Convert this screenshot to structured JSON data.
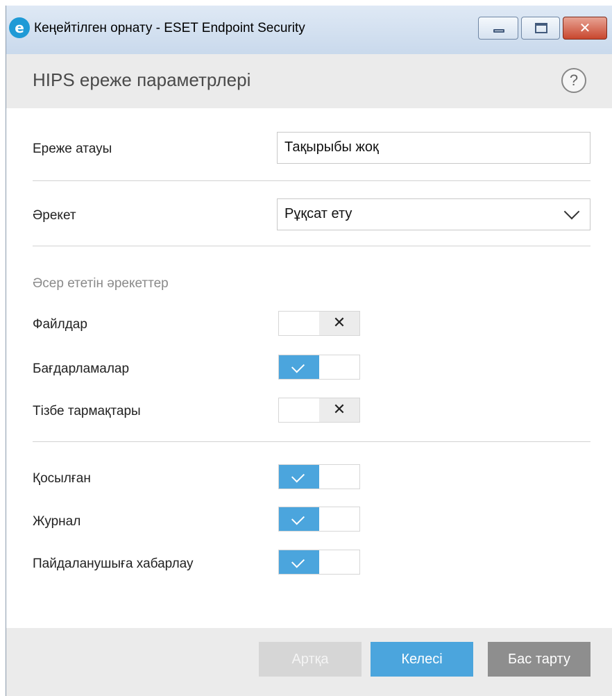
{
  "window": {
    "app_icon": "e",
    "title": "Кеңейтілген орнату - ESET Endpoint Security",
    "close_glyph": "✕"
  },
  "header": {
    "title": "HIPS ереже параметрлері",
    "help_glyph": "?"
  },
  "form": {
    "rule_name_label": "Ереже атауы",
    "rule_name_value": "Тақырыбы жоқ",
    "action_label": "Әрекет",
    "action_value": "Рұқсат ету"
  },
  "affected": {
    "section_title": "Әсер ететін әрекеттер",
    "items": [
      {
        "label": "Файлдар",
        "enabled": false
      },
      {
        "label": "Бағдарламалар",
        "enabled": true
      },
      {
        "label": "Тізбе тармақтары",
        "enabled": false
      }
    ]
  },
  "options": {
    "items": [
      {
        "label": "Қосылған",
        "enabled": true
      },
      {
        "label": "Журнал",
        "enabled": true
      },
      {
        "label": "Пайдаланушыға хабарлау",
        "enabled": true
      }
    ]
  },
  "toggle_glyphs": {
    "off": "✕"
  },
  "footer": {
    "back": "Артқа",
    "next": "Келесі",
    "cancel": "Бас тарту"
  },
  "colors": {
    "accent": "#4ba5dd",
    "header_bg": "#ebebeb",
    "cancel_bg": "#8e8e8e"
  }
}
